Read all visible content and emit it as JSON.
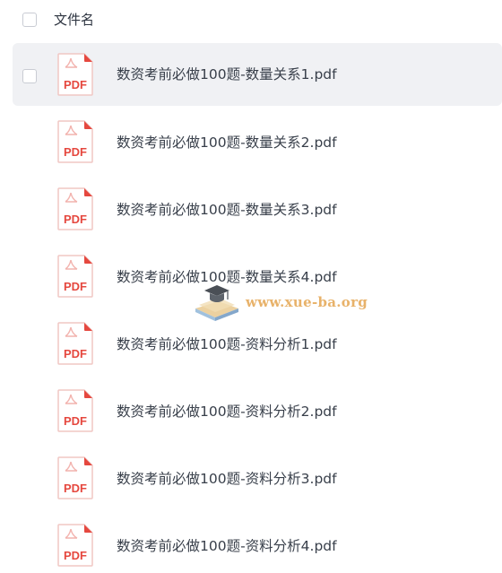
{
  "header": {
    "column_label": "文件名"
  },
  "files": [
    {
      "name": "数资考前必做100题-数量关系1.pdf",
      "type_label": "PDF"
    },
    {
      "name": "数资考前必做100题-数量关系2.pdf",
      "type_label": "PDF"
    },
    {
      "name": "数资考前必做100题-数量关系3.pdf",
      "type_label": "PDF"
    },
    {
      "name": "数资考前必做100题-数量关系4.pdf",
      "type_label": "PDF"
    },
    {
      "name": "数资考前必做100题-资料分析1.pdf",
      "type_label": "PDF"
    },
    {
      "name": "数资考前必做100题-资料分析2.pdf",
      "type_label": "PDF"
    },
    {
      "name": "数资考前必做100题-资料分析3.pdf",
      "type_label": "PDF"
    },
    {
      "name": "数资考前必做100题-资料分析4.pdf",
      "type_label": "PDF"
    }
  ],
  "watermark": {
    "text": "www.xue-ba.org"
  },
  "colors": {
    "pdf_red": "#e5483f",
    "hover_bg": "#f0f1f4",
    "watermark": "#e8b26a"
  }
}
